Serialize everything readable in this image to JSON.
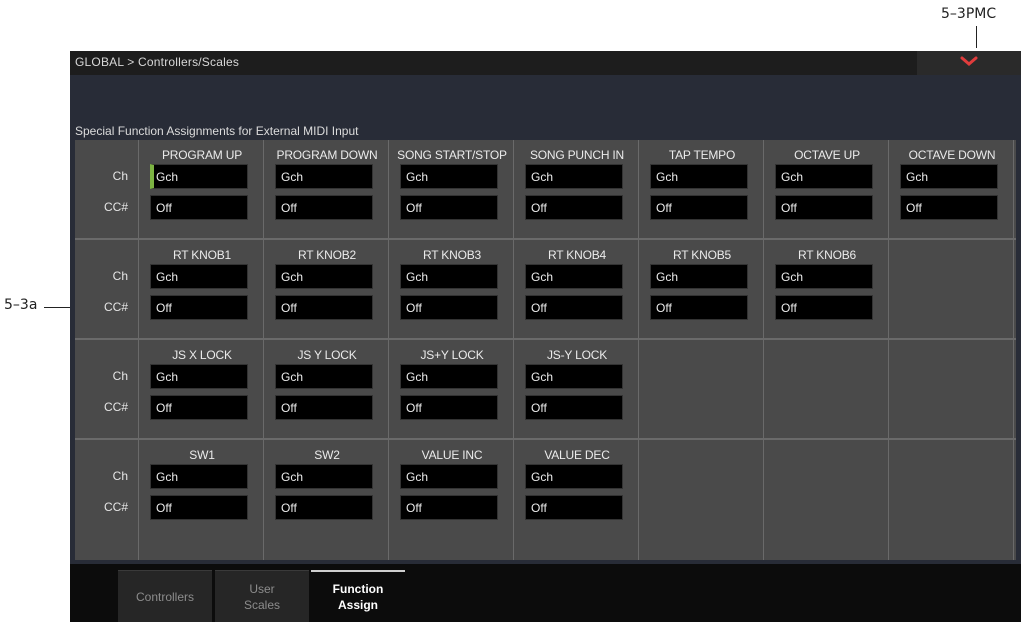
{
  "callouts": {
    "top": "5–3PMC",
    "left": "5–3a"
  },
  "header": {
    "breadcrumb": "GLOBAL > Controllers/Scales",
    "menu_icon": "chevron-down-icon",
    "menu_color": "#e03c3c"
  },
  "section": {
    "title": "Special Function Assignments for External MIDI Input"
  },
  "row_labels": {
    "ch": "Ch",
    "cc": "CC#"
  },
  "groups": [
    {
      "cells": [
        {
          "title": "PROGRAM UP",
          "ch": "Gch",
          "cc": "Off",
          "selected": true
        },
        {
          "title": "PROGRAM DOWN",
          "ch": "Gch",
          "cc": "Off"
        },
        {
          "title": "SONG START/STOP",
          "ch": "Gch",
          "cc": "Off"
        },
        {
          "title": "SONG PUNCH IN",
          "ch": "Gch",
          "cc": "Off"
        },
        {
          "title": "TAP TEMPO",
          "ch": "Gch",
          "cc": "Off"
        },
        {
          "title": "OCTAVE UP",
          "ch": "Gch",
          "cc": "Off"
        },
        {
          "title": "OCTAVE DOWN",
          "ch": "Gch",
          "cc": "Off"
        }
      ]
    },
    {
      "cells": [
        {
          "title": "RT KNOB1",
          "ch": "Gch",
          "cc": "Off"
        },
        {
          "title": "RT KNOB2",
          "ch": "Gch",
          "cc": "Off"
        },
        {
          "title": "RT KNOB3",
          "ch": "Gch",
          "cc": "Off"
        },
        {
          "title": "RT KNOB4",
          "ch": "Gch",
          "cc": "Off"
        },
        {
          "title": "RT KNOB5",
          "ch": "Gch",
          "cc": "Off"
        },
        {
          "title": "RT KNOB6",
          "ch": "Gch",
          "cc": "Off"
        }
      ]
    },
    {
      "cells": [
        {
          "title": "JS X LOCK",
          "ch": "Gch",
          "cc": "Off"
        },
        {
          "title": "JS Y LOCK",
          "ch": "Gch",
          "cc": "Off"
        },
        {
          "title": "JS+Y LOCK",
          "ch": "Gch",
          "cc": "Off"
        },
        {
          "title": "JS-Y LOCK",
          "ch": "Gch",
          "cc": "Off"
        }
      ]
    },
    {
      "cells": [
        {
          "title": "SW1",
          "ch": "Gch",
          "cc": "Off"
        },
        {
          "title": "SW2",
          "ch": "Gch",
          "cc": "Off"
        },
        {
          "title": "VALUE INC",
          "ch": "Gch",
          "cc": "Off"
        },
        {
          "title": "VALUE DEC",
          "ch": "Gch",
          "cc": "Off"
        }
      ]
    }
  ],
  "tabs": [
    {
      "label": "Controllers",
      "active": false
    },
    {
      "label": "User\nScales",
      "active": false
    },
    {
      "label": "Function\nAssign",
      "active": true
    }
  ],
  "colors": {
    "selection_marker": "#7cb342",
    "panel": "#282c37",
    "grid": "#4a4a4a"
  }
}
